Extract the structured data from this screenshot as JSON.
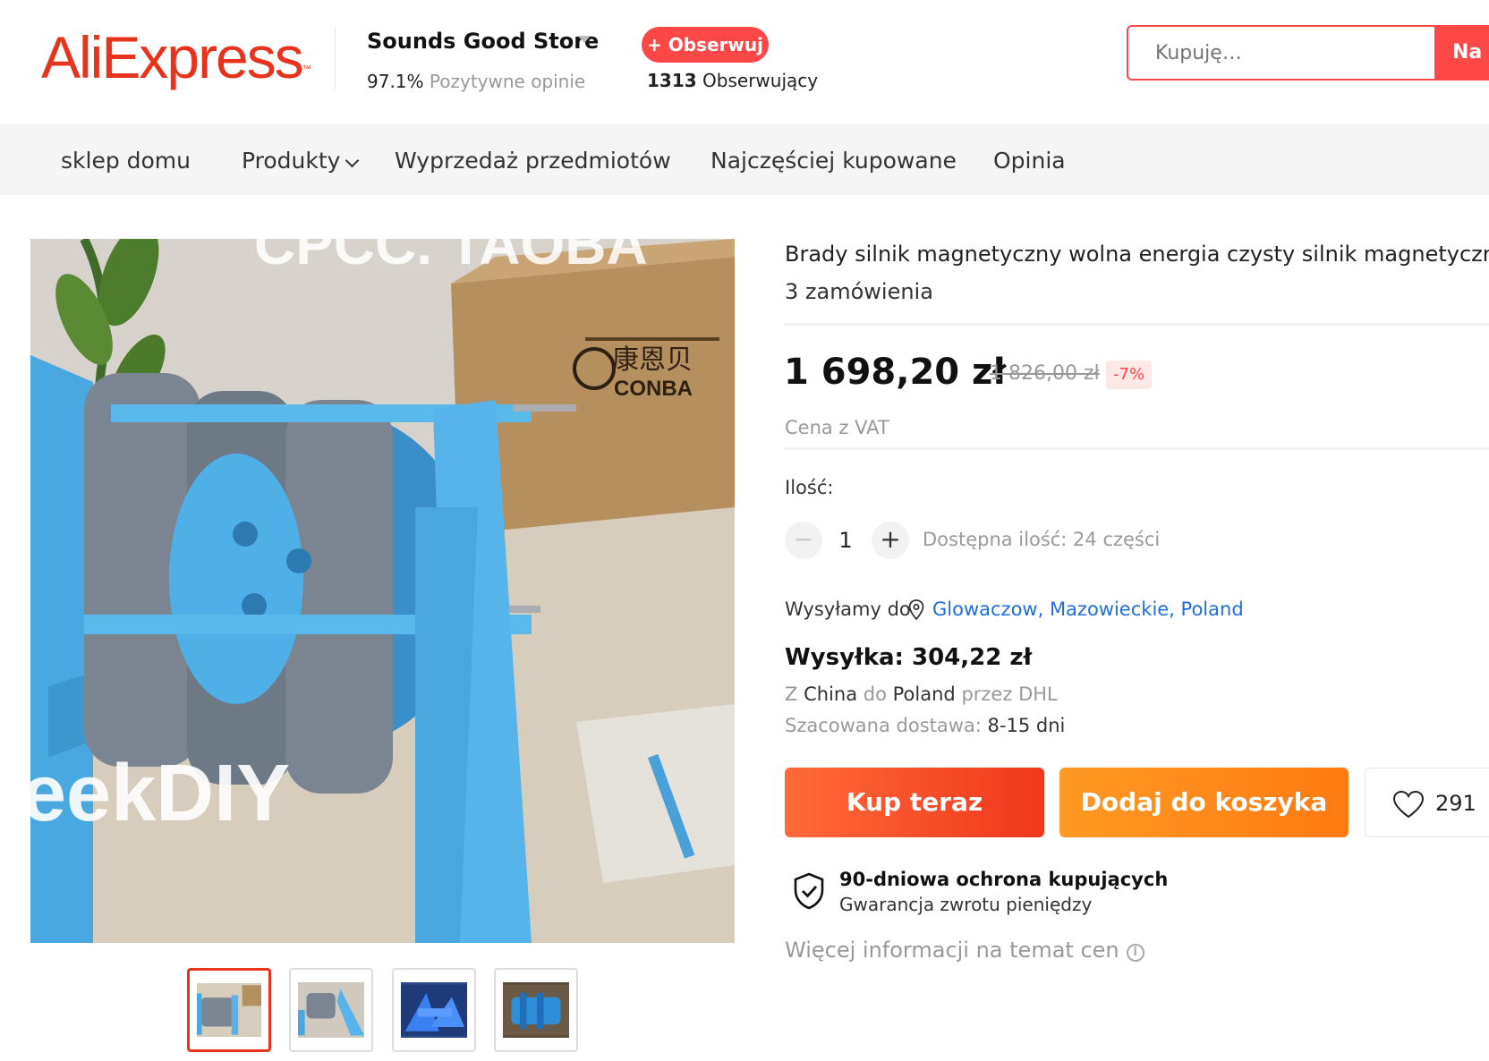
{
  "header": {
    "logo_text": "AliExpress",
    "logo_tm": "™",
    "store_name": "Sounds Good Store",
    "rating_percent": "97.1%",
    "rating_label": "Pozytywne opinie",
    "follow_label": "+ Obserwuj",
    "followers_count": "1313",
    "followers_label": "Obserwujący",
    "search_placeholder": "Kupuję…",
    "search_button": "Na A"
  },
  "nav": {
    "items": [
      "sklep domu",
      "Produkty",
      "Wyprzedaż przedmiotów",
      "Najczęściej kupowane",
      "Opinia"
    ]
  },
  "image": {
    "watermark_top": "CPCC. TAOBA",
    "watermark_bottom": "eekDIY",
    "box_brand": "康恩贝",
    "box_brand_latin": "CONBA"
  },
  "product": {
    "title": "Brady silnik magnetyczny wolna energia czysty silnik magnetyczny",
    "orders": "3 zamówienia",
    "price": "1 698,20 zł",
    "old_price": "1 826,00 zł",
    "discount": "-7%",
    "vat_note": "Cena z VAT",
    "quantity_label": "Ilość:",
    "quantity_value": "1",
    "minus": "−",
    "plus": "+",
    "availability": "Dostępna ilość: 24 części",
    "ship_to_label": "Wysyłamy do",
    "ship_location": "Glowaczow, Mazowieckie, Poland",
    "shipping": "Wysyłka: 304,22 zł",
    "route_from_prefix": "Z",
    "route_from": "China",
    "route_to_prefix": "do",
    "route_to": "Poland",
    "route_via_prefix": "przez",
    "route_via": "DHL",
    "eta_label": "Szacowana dostawa:",
    "eta_value": "8-15 dni",
    "buy_now": "Kup teraz",
    "add_to_cart": "Dodaj do koszyka",
    "wishlist_count": "291",
    "protection_title": "90-dniowa ochrona kupujących",
    "protection_sub": "Gwarancja zwrotu pieniędzy",
    "more_info": "Więcej informacji na temat cen",
    "info_glyph": "i"
  },
  "colors": {
    "brand": "#e8331c",
    "accent_red": "#ff4747",
    "buy_gradient_start": "#ff6a3a",
    "cart_gradient_start": "#ff9a24",
    "link_blue": "#1f6fe0"
  },
  "icons": [
    "chevron-down-icon",
    "location-pin-icon",
    "heart-icon",
    "shield-check-icon",
    "info-icon"
  ]
}
